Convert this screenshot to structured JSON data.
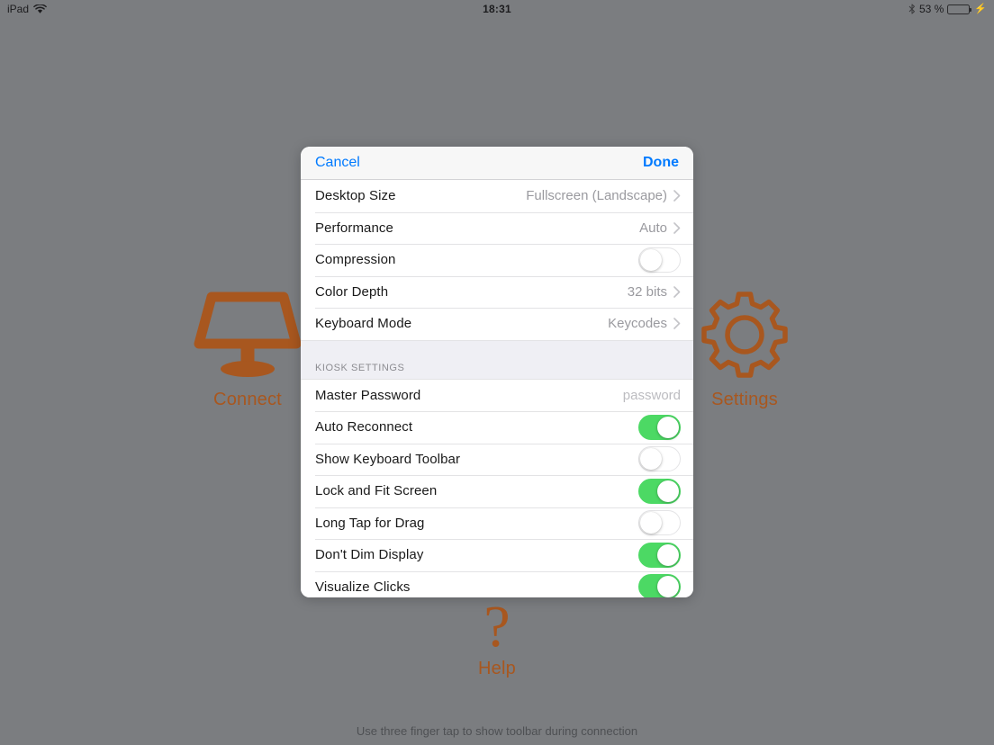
{
  "statusbar": {
    "device": "iPad",
    "wifi_icon": "wifi-icon",
    "time": "18:31",
    "bluetooth_icon": "bluetooth-icon",
    "battery_percent": "53 %",
    "battery_level": 53,
    "battery_icon": "battery-icon",
    "charging_icon": "charging-bolt-icon"
  },
  "home": {
    "connect": {
      "label": "Connect",
      "icon": "desktop-lamp-icon"
    },
    "settings": {
      "label": "Settings",
      "icon": "gear-icon"
    },
    "help": {
      "label": "Help",
      "icon": "question-mark-icon"
    },
    "hint": "Use three finger tap to show toolbar during connection"
  },
  "modal": {
    "cancel_label": "Cancel",
    "done_label": "Done",
    "accent_color": "#007aff",
    "toggle_on_color": "#4cd964",
    "rows": [
      {
        "label": "Desktop Size",
        "value": "Fullscreen (Landscape)",
        "type": "disclosure"
      },
      {
        "label": "Performance",
        "value": "Auto",
        "type": "disclosure"
      },
      {
        "label": "Compression",
        "value": "off",
        "type": "toggle"
      },
      {
        "label": "Color Depth",
        "value": "32 bits",
        "type": "disclosure"
      },
      {
        "label": "Keyboard Mode",
        "value": "Keycodes",
        "type": "disclosure"
      }
    ],
    "section": {
      "title": "KIOSK SETTINGS",
      "rows": [
        {
          "label": "Master Password",
          "placeholder": "password",
          "type": "text"
        },
        {
          "label": "Auto Reconnect",
          "value": "on",
          "type": "toggle"
        },
        {
          "label": "Show Keyboard Toolbar",
          "value": "off",
          "type": "toggle"
        },
        {
          "label": "Lock and Fit Screen",
          "value": "on",
          "type": "toggle"
        },
        {
          "label": "Long Tap for Drag",
          "value": "off",
          "type": "toggle"
        },
        {
          "label": "Don't Dim Display",
          "value": "on",
          "type": "toggle"
        },
        {
          "label": "Visualize Clicks",
          "value": "on",
          "type": "toggle"
        }
      ]
    }
  }
}
